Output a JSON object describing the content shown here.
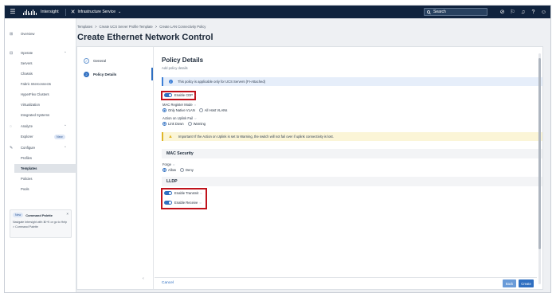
{
  "topbar": {
    "app_name": "Intersight",
    "service": "Infrastructure Service",
    "search_placeholder": "Search",
    "icons": [
      "menu-icon",
      "cisco-logo",
      "service-icon",
      "search-icon",
      "check-circle-icon",
      "megaphone-icon",
      "bell-icon",
      "help-icon",
      "user-icon"
    ]
  },
  "sidebar": {
    "items": [
      {
        "label": "Overview",
        "icon": "overview-icon"
      },
      {
        "label": "Operate",
        "icon": "operate-icon"
      },
      {
        "label": "Servers"
      },
      {
        "label": "Chassis"
      },
      {
        "label": "Fabric Interconnects"
      },
      {
        "label": "HyperFlex Clusters"
      },
      {
        "label": "Virtualization"
      },
      {
        "label": "Integrated Systems"
      },
      {
        "label": "Analyze",
        "icon": "analyze-icon"
      },
      {
        "label": "Explorer",
        "badge": "New"
      },
      {
        "label": "Configure",
        "icon": "configure-icon"
      },
      {
        "label": "Profiles"
      },
      {
        "label": "Templates"
      },
      {
        "label": "Policies"
      },
      {
        "label": "Pools"
      }
    ],
    "palette": {
      "badge": "New",
      "title": "Command Palette",
      "description": "Navigate Intersight with ⌘+K or go to Help > Command Palette"
    }
  },
  "breadcrumb": [
    "Templates",
    "Create UCS Server Profile Template",
    "Create LAN Connectivity Policy"
  ],
  "breadcrumb_separator": ">",
  "page_title": "Create Ethernet Network Control",
  "steps": [
    {
      "number": "✓",
      "label": "General"
    },
    {
      "number": "2",
      "label": "Policy Details"
    }
  ],
  "policy": {
    "title": "Policy Details",
    "subtitle": "Add policy details",
    "info_text": "This policy is applicable only for UCS Servers (FI-Attached)",
    "enable_cdp_label": "Enable CDP",
    "mac_register_mode_label": "MAC Register Mode",
    "mac_register_options": [
      "Only Native VLAN",
      "All Host VLANs"
    ],
    "action_on_uplink_fail_label": "Action on Uplink Fail",
    "uplink_fail_options": [
      "Link Down",
      "Warning"
    ],
    "warning_text": "Important! If the Action on Uplink is set to Warning, the switch will not fail over if uplink connectivity is lost.",
    "mac_security_heading": "MAC Security",
    "forge_label": "Forge",
    "forge_options": [
      "Allow",
      "Deny"
    ],
    "lldp_heading": "LLDP",
    "enable_transmit_label": "Enable Transmit",
    "enable_receive_label": "Enable Receive"
  },
  "footer": {
    "cancel_label": "Cancel",
    "back_label": "Back",
    "create_label": "Create"
  },
  "colors": {
    "accent": "#2f6fc1",
    "topbar": "#10233e",
    "highlight_box": "#c0121b",
    "warning": "#e0b62a"
  }
}
